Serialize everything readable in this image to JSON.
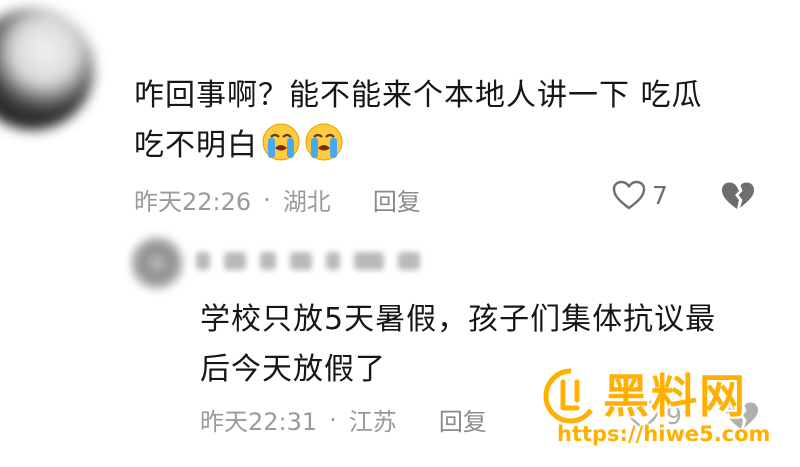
{
  "colors": {
    "text": "#161616",
    "meta": "#9a9a9a",
    "icon": "#6e6e6e",
    "watermark": "#ffb000"
  },
  "comments": [
    {
      "avatar_icon": "blurred-avatar",
      "text_line1": "咋回事啊？能不能来个本地人讲一下 吃瓜",
      "text_line2": "吃不明白",
      "emojis": [
        "loudly-crying-face",
        "loudly-crying-face"
      ],
      "time": "昨天22:26",
      "separator": "·",
      "location": "湖北",
      "reply_label": "回复",
      "like_count": "7"
    },
    {
      "avatar_icon": "blurred-avatar",
      "text_line1": "学校只放5天暑假，孩子们集体抗议最",
      "text_line2": "后今天放假了",
      "time": "昨天22:31",
      "separator": "·",
      "location": "江苏",
      "reply_label": "回复",
      "like_count": "9"
    }
  ],
  "watermark": {
    "title": "黑料网",
    "url": "https://hiwe5.com"
  }
}
